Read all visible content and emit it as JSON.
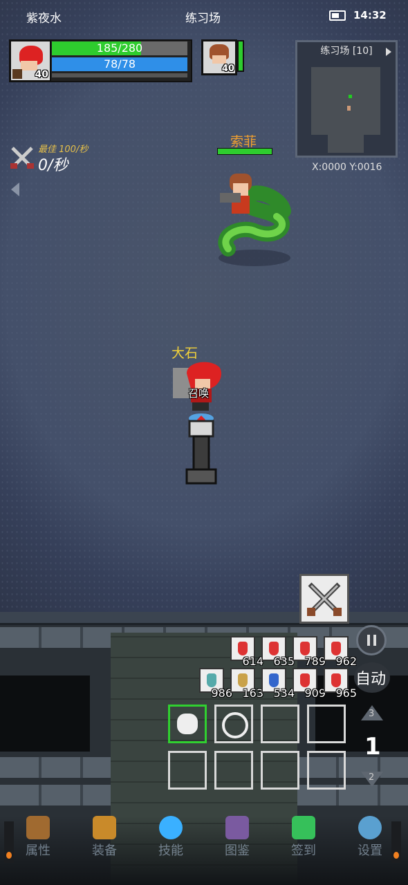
{
  "status_bar": {
    "left_text": "紫夜水",
    "center_text": "练习场",
    "time": "14:32"
  },
  "player": {
    "level": "40",
    "hp": "185/280",
    "hp_fraction": 0.66,
    "mp": "78/78",
    "mp_fraction": 1.0
  },
  "pet": {
    "level": "40"
  },
  "minimap": {
    "title": "练习场 [10]",
    "coords": "X:0000  Y:0016"
  },
  "dps": {
    "best": "最佳 100/秒",
    "current": "0/秒"
  },
  "enemy": {
    "name": "索菲"
  },
  "hero": {
    "name": "大石",
    "summon_label": "召唤"
  },
  "potions_row1": [
    {
      "count": "614",
      "color": "#d33"
    },
    {
      "count": "635",
      "color": "#d33"
    },
    {
      "count": "789",
      "color": "#d33"
    },
    {
      "count": "962",
      "color": "#d33"
    }
  ],
  "potions_row2": [
    {
      "count": "986",
      "color": "#5aa"
    },
    {
      "count": "163",
      "color": "#c9a24a"
    },
    {
      "count": "534",
      "color": "#36c"
    },
    {
      "count": "909",
      "color": "#d33"
    },
    {
      "count": "965",
      "color": "#d33"
    }
  ],
  "controls": {
    "auto_label": "自动",
    "speed_current": "1",
    "speed_up": "3",
    "speed_down": "2"
  },
  "nav": [
    {
      "label": "属性",
      "icon": "helmet-icon"
    },
    {
      "label": "装备",
      "icon": "bag-icon"
    },
    {
      "label": "技能",
      "icon": "gem-icon"
    },
    {
      "label": "图鉴",
      "icon": "book-icon"
    },
    {
      "label": "签到",
      "icon": "emerald-icon"
    },
    {
      "label": "设置",
      "icon": "gear-icon"
    }
  ],
  "colors": {
    "hp": "#2ecc2e",
    "mp": "#2f8fe8",
    "name_enemy": "#f0a030",
    "name_hero": "#f2d23a"
  }
}
